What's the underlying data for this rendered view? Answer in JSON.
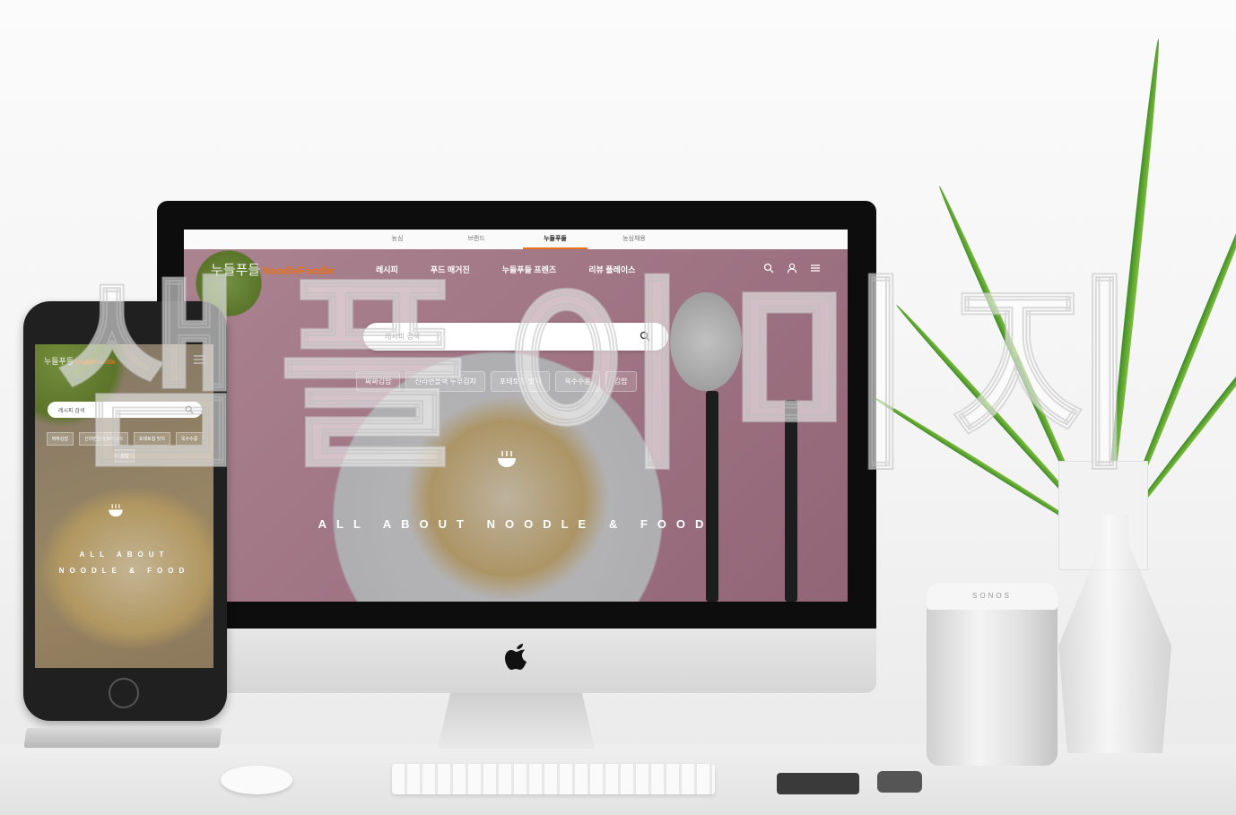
{
  "desktop": {
    "topbar": [
      "농심",
      "브랜드",
      "누들푸들",
      "농심채용"
    ],
    "topbar_active": 2,
    "logo_ko": "누들푸들",
    "logo_en": "NoodleFoodle",
    "menu": [
      "레시피",
      "푸드 매거진",
      "누들푸들 프렌즈",
      "리뷰 플레이스"
    ],
    "search_placeholder": "레시피 검색",
    "tags": [
      "짜짜김밥",
      "신라면블랙 두부김치",
      "포테토칩 맛치",
      "옥수수콩",
      "김밥"
    ],
    "hero": "ALL ABOUT NOODLE & FOOD"
  },
  "mobile": {
    "logo_ko": "누들푸들",
    "logo_en": "NoodleFoodle",
    "search_placeholder": "레시피 검색",
    "tags": [
      "짜짜김밥",
      "신라면블랙 두부김치",
      "포테토칩 맛치",
      "옥수수콩",
      "김밥"
    ],
    "hero_line1": "ALL ABOUT",
    "hero_line2": "NOODLE & FOOD"
  },
  "speaker_brand": "SONOS",
  "watermark": "샘플이미지",
  "colors": {
    "accent": "#e8711a",
    "screen_bg": "#c8a0aa"
  }
}
